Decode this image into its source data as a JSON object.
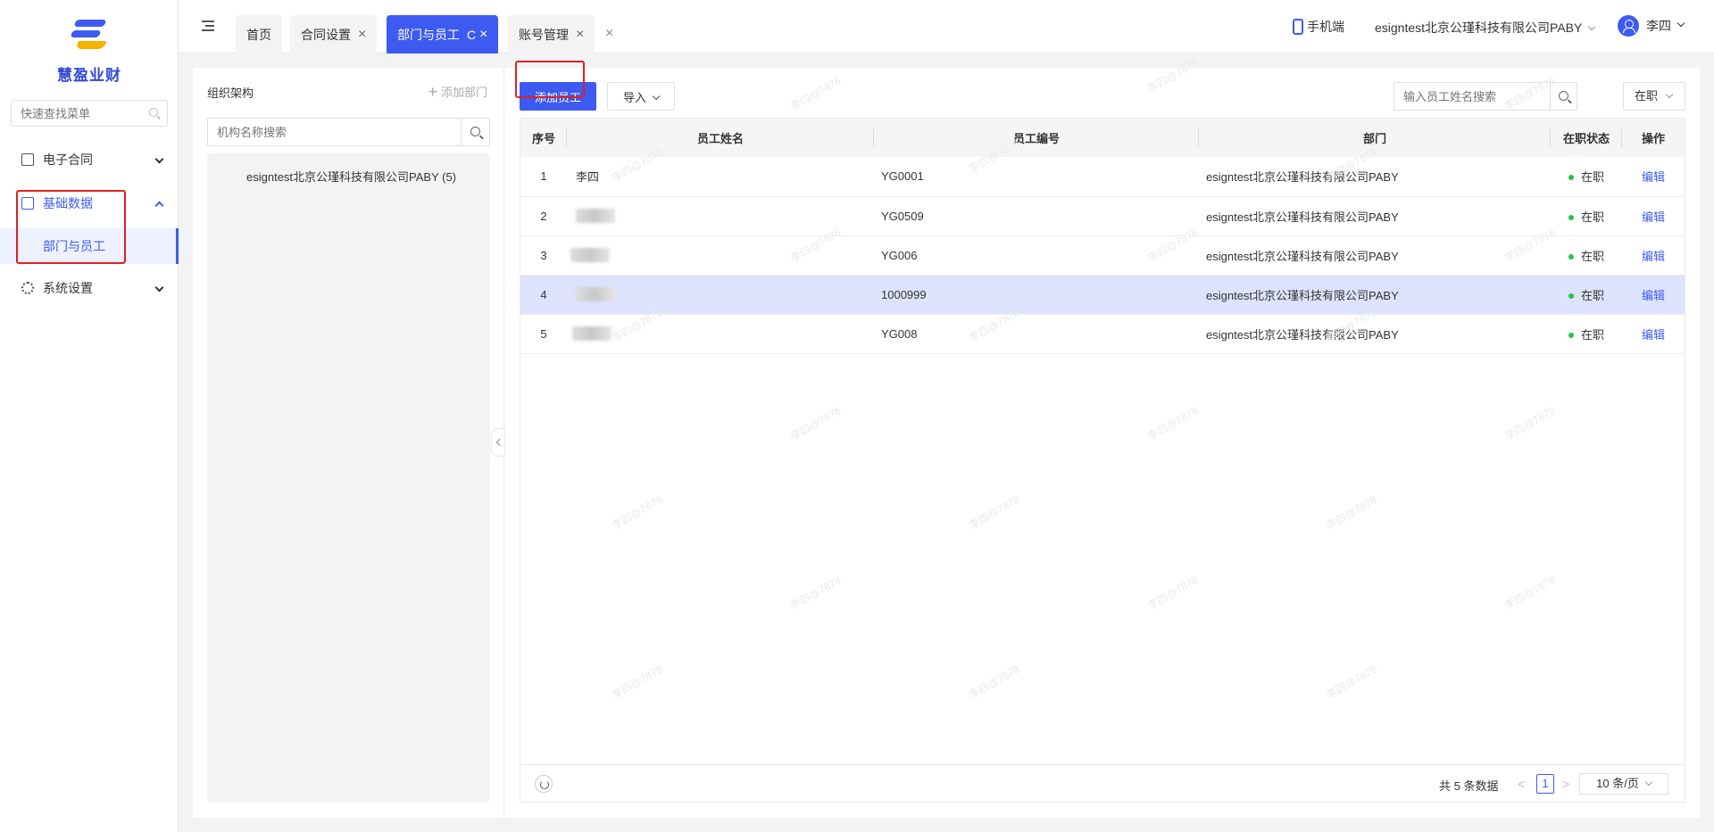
{
  "app": {
    "name": "慧盈业财"
  },
  "sidebar": {
    "search_placeholder": "快速查找菜单",
    "menu": [
      {
        "label": "电子合同",
        "icon": "contract-icon",
        "expanded": false
      },
      {
        "label": "基础数据",
        "icon": "data-icon",
        "expanded": true,
        "children": [
          {
            "label": "部门与员工",
            "active": true
          }
        ]
      },
      {
        "label": "系统设置",
        "icon": "gear-icon",
        "expanded": false
      }
    ]
  },
  "topbar": {
    "tabs": [
      {
        "label": "首页",
        "closable": false
      },
      {
        "label": "合同设置",
        "closable": true
      },
      {
        "label": "部门与员工",
        "closable": true,
        "active": true,
        "refresh": "C"
      },
      {
        "label": "账号管理",
        "closable": true
      }
    ],
    "close_glyph": "×",
    "mobile_label": "手机端",
    "company": "esigntest北京公瑾科技有限公司PABY",
    "user": "李四"
  },
  "org": {
    "title": "组织架构",
    "add_label": "添加部门",
    "add_glyph": "+",
    "search_placeholder": "机构名称搜索",
    "tree_root": "esigntest北京公瑾科技有限公司PABY (5)"
  },
  "employees": {
    "add_button": "添加员工",
    "import_button": "导入",
    "search_placeholder": "输入员工姓名搜索",
    "status_filter": "在职",
    "columns": [
      "序号",
      "员工姓名",
      "员工编号",
      "部门",
      "在职状态",
      "操作"
    ],
    "rows": [
      {
        "no": "1",
        "name": "李四",
        "code": "YG0001",
        "dept": "esigntest北京公瑾科技有限公司PABY",
        "status": "在职",
        "action": "编辑"
      },
      {
        "no": "2",
        "name": "",
        "code": "YG0509",
        "dept": "esigntest北京公瑾科技有限公司PABY",
        "status": "在职",
        "action": "编辑"
      },
      {
        "no": "3",
        "name": "",
        "code": "YG006",
        "dept": "esigntest北京公瑾科技有限公司PABY",
        "status": "在职",
        "action": "编辑"
      },
      {
        "no": "4",
        "name": "",
        "code": "1000999",
        "dept": "esigntest北京公瑾科技有限公司PABY",
        "status": "在职",
        "action": "编辑",
        "highlighted": true
      },
      {
        "no": "5",
        "name": "",
        "code": "YG008",
        "dept": "esigntest北京公瑾科技有限公司PABY",
        "status": "在职",
        "action": "编辑"
      }
    ]
  },
  "pagination": {
    "total_text": "共 5 条数据",
    "current_page": "1",
    "prev": "<",
    "next": ">",
    "page_size": "10 条/页"
  },
  "watermark": "李四@7878",
  "colors": {
    "primary": "#3d5af1",
    "highlight_row": "#dde3fc",
    "status_dot": "#2bbf4a",
    "annotation": "#e02020"
  }
}
